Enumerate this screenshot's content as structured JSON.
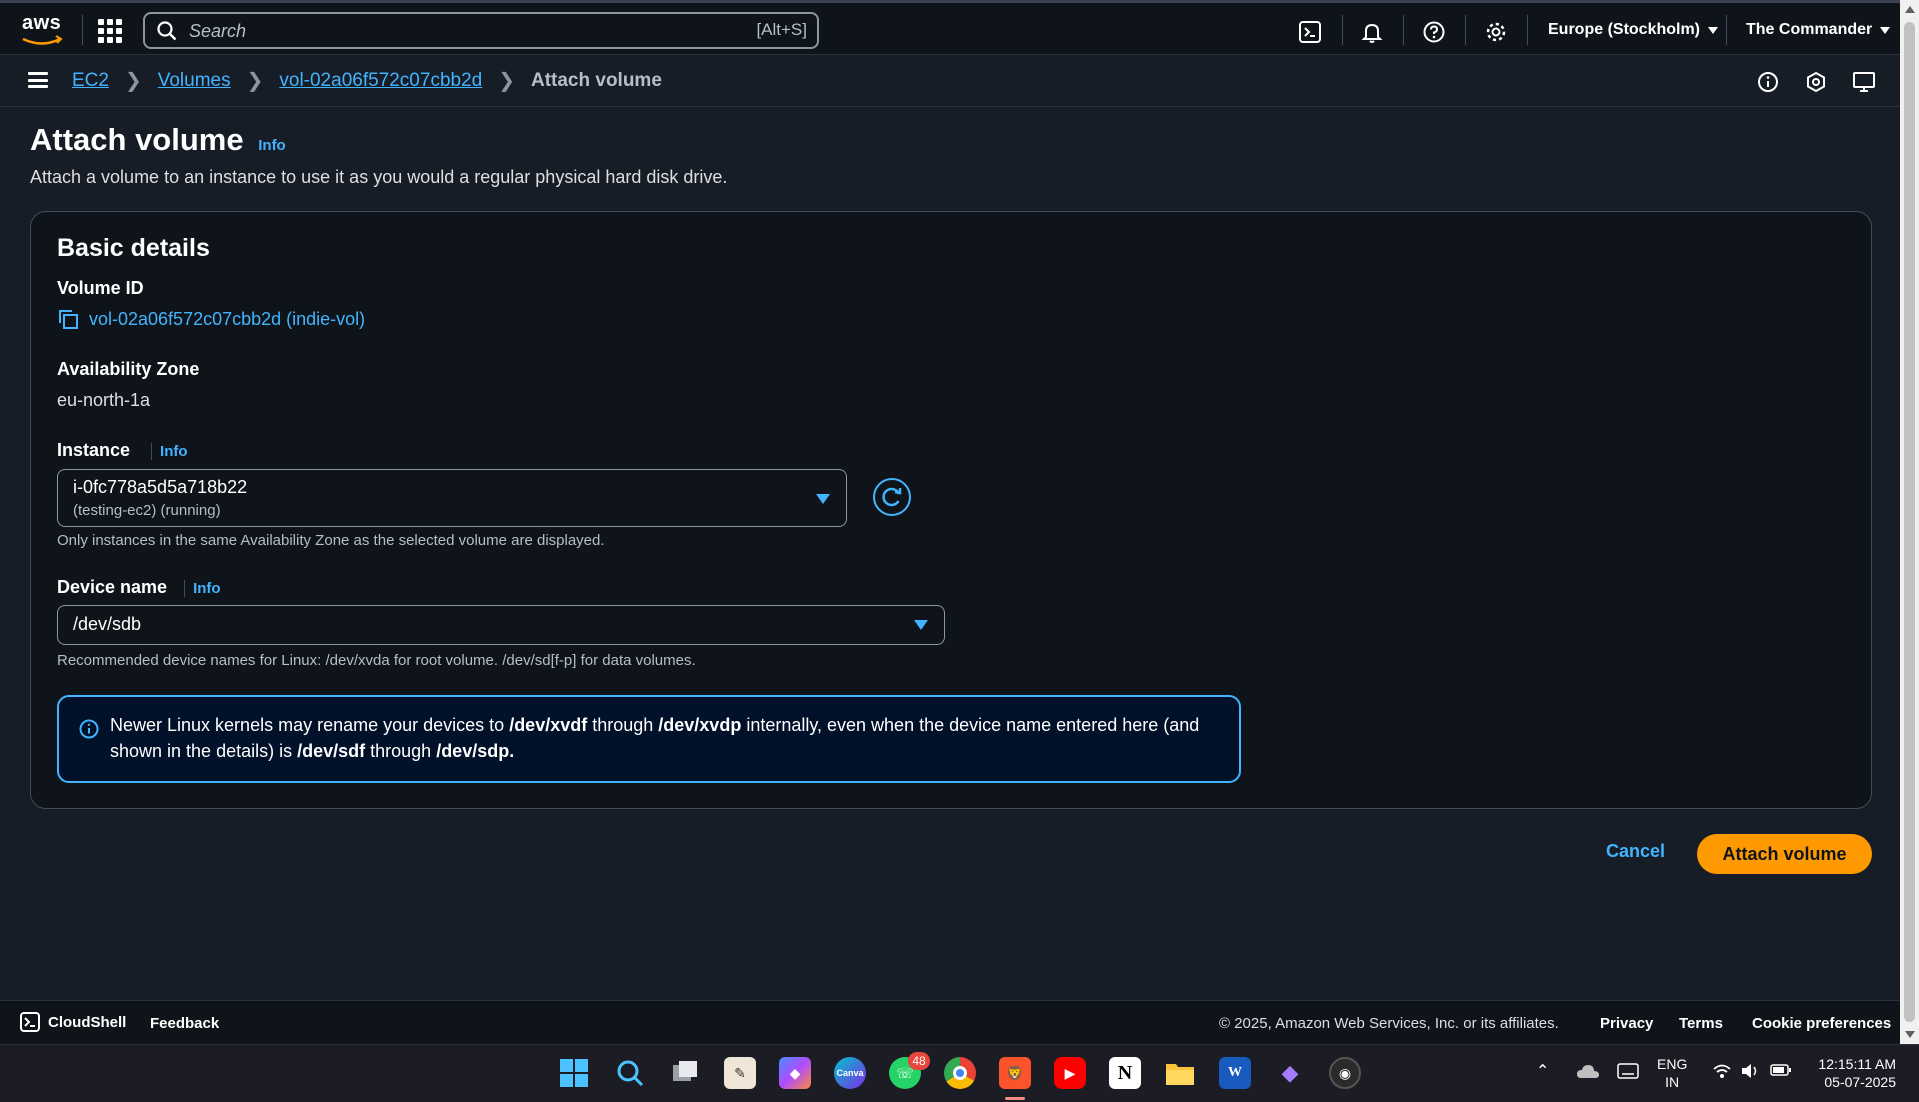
{
  "topnav": {
    "logo_text": "aws",
    "search_placeholder": "Search",
    "search_shortcut": "[Alt+S]",
    "region": "Europe (Stockholm)",
    "user": "The Commander"
  },
  "breadcrumb": {
    "items": [
      "EC2",
      "Volumes",
      "vol-02a06f572c07cbb2d"
    ],
    "current": "Attach volume"
  },
  "page": {
    "title": "Attach volume",
    "info": "Info",
    "description": "Attach a volume to an instance to use it as you would a regular physical hard disk drive."
  },
  "basic_details": {
    "title": "Basic details",
    "volume_id_label": "Volume ID",
    "volume_id_value": "vol-02a06f572c07cbb2d (indie-vol)",
    "az_label": "Availability Zone",
    "az_value": "eu-north-1a",
    "instance_label": "Instance",
    "instance_info": "Info",
    "instance_value": "i-0fc778a5d5a718b22",
    "instance_sub": "(testing-ec2) (running)",
    "instance_hint": "Only instances in the same Availability Zone as the selected volume are displayed.",
    "device_label": "Device name",
    "device_info": "Info",
    "device_value": "/dev/sdb",
    "device_hint": "Recommended device names for Linux: /dev/xvda for root volume. /dev/sd[f-p] for data volumes."
  },
  "alert": {
    "t1": "Newer Linux kernels may rename your devices to ",
    "b1": "/dev/xvdf",
    "t2": " through ",
    "b2": "/dev/xvdp",
    "t3": " internally, even when the device name entered here (and shown in the details) is ",
    "b3": "/dev/sdf",
    "t4": " through ",
    "b4": "/dev/sdp."
  },
  "actions": {
    "cancel": "Cancel",
    "attach": "Attach volume"
  },
  "footer": {
    "cloudshell": "CloudShell",
    "feedback": "Feedback",
    "copyright": "© 2025, Amazon Web Services, Inc. or its affiliates.",
    "privacy": "Privacy",
    "terms": "Terms",
    "cookies": "Cookie preferences"
  },
  "taskbar": {
    "whatsapp_badge": "48",
    "lang_top": "ENG",
    "lang_bottom": "IN",
    "time": "12:15:11 AM",
    "date": "05-07-2025"
  },
  "colors": {
    "accent": "#42b4ff",
    "primary_button": "#ff9900",
    "background": "#161d26"
  }
}
